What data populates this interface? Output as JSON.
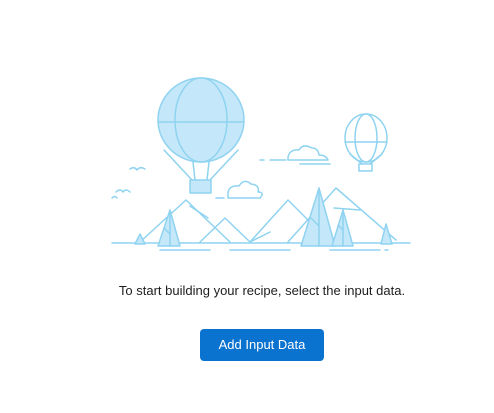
{
  "empty_state": {
    "illustration_icon": "hot-air-balloons-over-mountains-illustration",
    "message": "To start building your recipe, select the input data.",
    "button_label": "Add Input Data"
  },
  "colors": {
    "accent": "#0a72cf",
    "illustration_stroke": "#8fd3f0",
    "illustration_fill": "#c4e8fa"
  }
}
